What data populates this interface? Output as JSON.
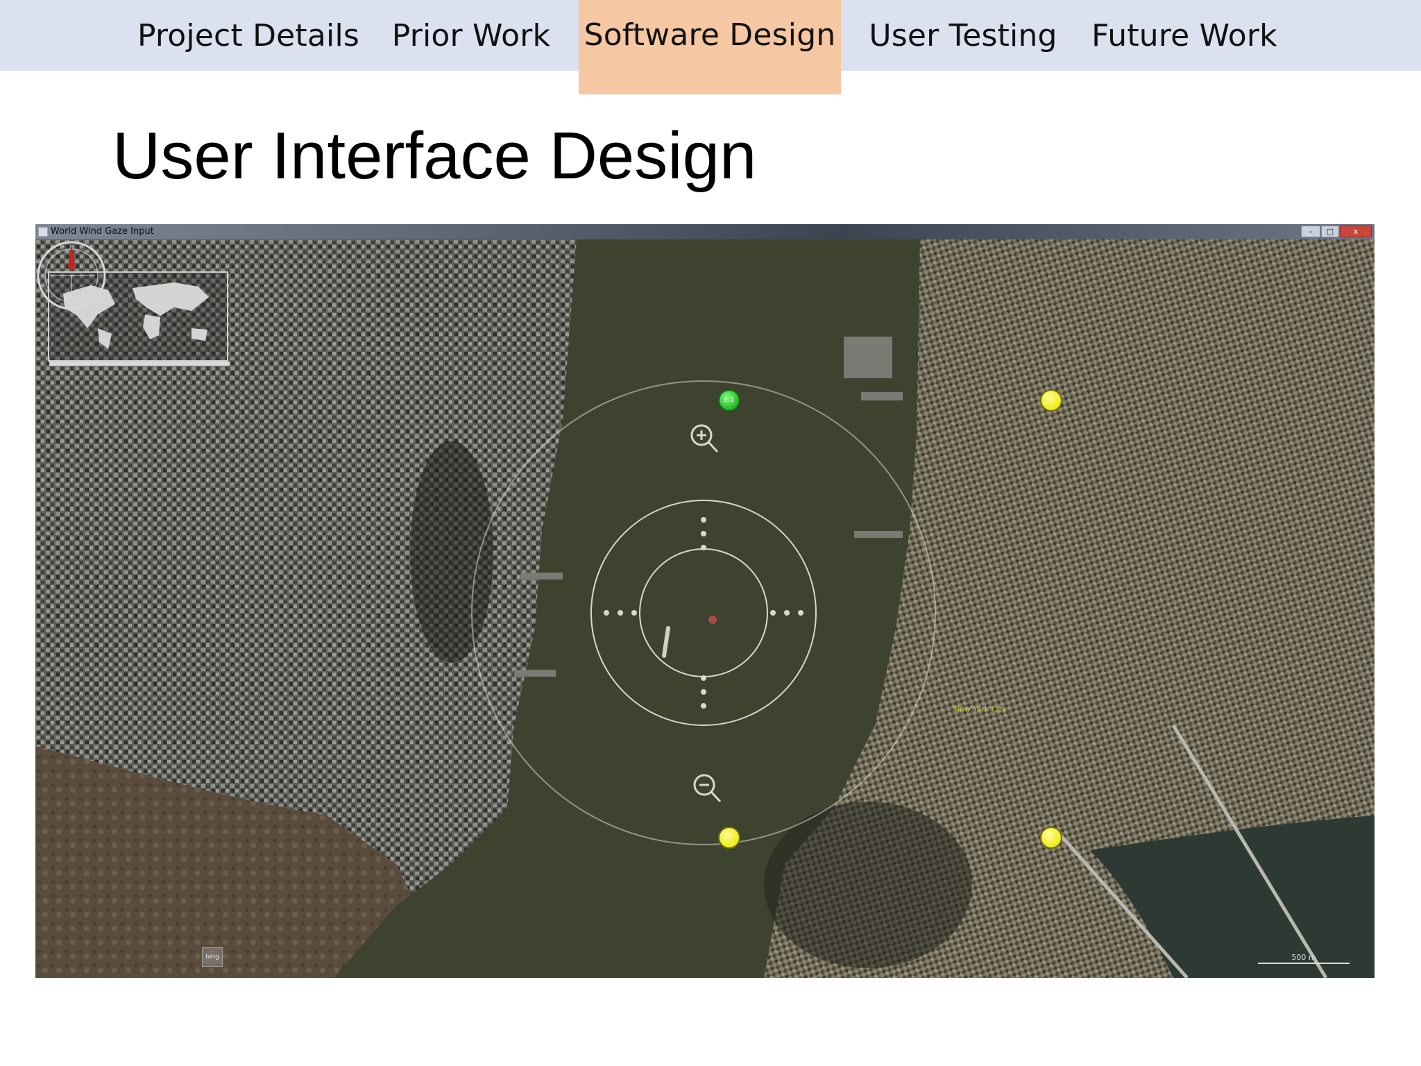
{
  "nav": {
    "tabs": [
      {
        "label": "Project Details",
        "active": false
      },
      {
        "label": "Prior Work",
        "active": false
      },
      {
        "label": "Software Design",
        "active": true
      },
      {
        "label": "User Testing",
        "active": false
      },
      {
        "label": "Future Work",
        "active": false
      }
    ],
    "active_color": "#f6c7a3",
    "bar_color": "#dce1f0"
  },
  "slide": {
    "title": "User Interface Design"
  },
  "window": {
    "title": "World Wind Gaze Input",
    "controls": {
      "minimize": "–",
      "maximize": "□",
      "close": "x"
    }
  },
  "map": {
    "imagery": "satellite view of lower Manhattan and Jersey City across the Hudson River",
    "pois": [
      {
        "color": "green",
        "label": "E-1"
      },
      {
        "color": "yellow",
        "label": ""
      },
      {
        "color": "yellow",
        "label": ""
      },
      {
        "color": "yellow",
        "label": ""
      }
    ],
    "city_label": "New York City",
    "scale_text": "500 m",
    "logo_text": "bing",
    "icons": [
      "zoom-in-icon",
      "zoom-out-icon",
      "compass-icon",
      "crosshair-icon"
    ]
  }
}
